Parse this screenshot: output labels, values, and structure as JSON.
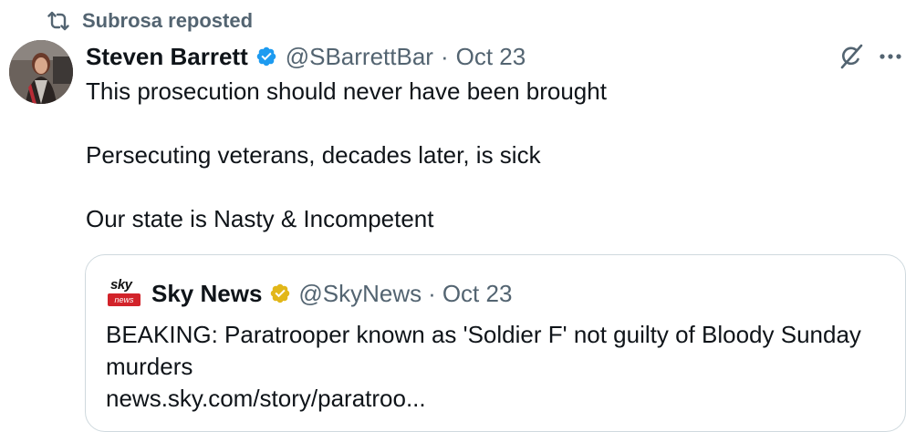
{
  "repost": {
    "text": "Subrosa reposted",
    "icon": "repost-icon"
  },
  "author": {
    "name": "Steven Barrett",
    "handle": "@SBarrettBar",
    "separator": "·",
    "date": "Oct 23",
    "verified_color": "#1d9bf0"
  },
  "tweet": {
    "paragraphs": [
      "This prosecution should never have been brought",
      "Persecuting veterans, decades later, is sick",
      "Our state is Nasty & Incompetent"
    ]
  },
  "actions": {
    "grok_icon": "grok-icon",
    "more_icon": "more-icon"
  },
  "quote": {
    "logo_top": "sky",
    "logo_bottom": "news",
    "name": "Sky News",
    "handle": "@SkyNews",
    "separator": "·",
    "date": "Oct 23",
    "verified_color": "#e2b719",
    "text": "BEAKING: Paratrooper known as 'Soldier F' not guilty of Bloody Sunday murders",
    "link": "news.sky.com/story/paratroo..."
  },
  "colors": {
    "text": "#0f1419",
    "secondary": "#536471",
    "border": "#cfd9de",
    "sky_red": "#d2232a"
  }
}
